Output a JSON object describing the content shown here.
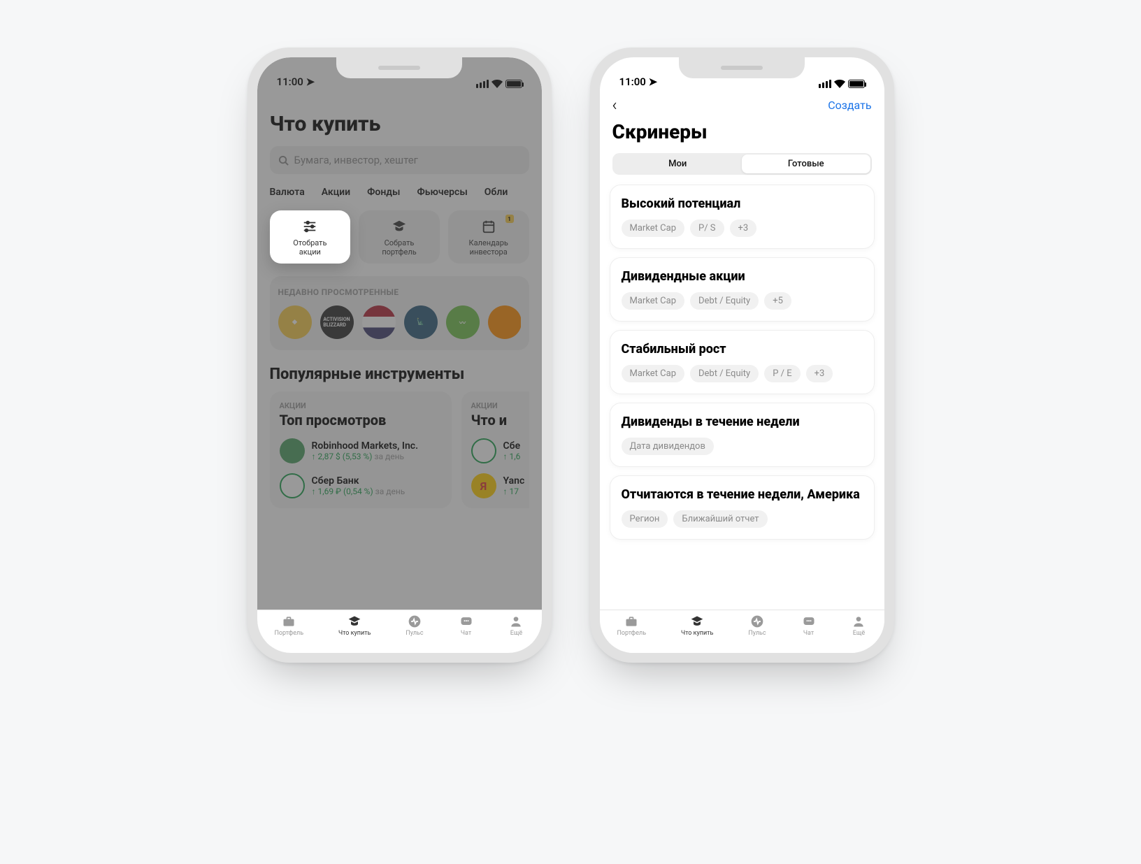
{
  "statusbar": {
    "time": "11:00"
  },
  "left": {
    "title": "Что купить",
    "search_placeholder": "Бумага, инвестор, хештег",
    "categories": [
      "Валюта",
      "Акции",
      "Фонды",
      "Фьючерсы",
      "Обли"
    ],
    "quick": [
      {
        "label": "Отобрать\nакции"
      },
      {
        "label": "Собрать\nпортфель"
      },
      {
        "label": "Календарь\nинвестора",
        "badge": "1"
      }
    ],
    "recent_label": "НЕДАВНО ПРОСМОТРЕННЫЕ",
    "popular_title": "Популярные инструменты",
    "cards": [
      {
        "cat": "АКЦИИ",
        "title": "Топ просмотров",
        "items": [
          {
            "name": "Robinhood Markets, Inc.",
            "delta": "↑ 2,87 $ (5,53 %)",
            "period": "за день"
          },
          {
            "name": "Сбер Банк",
            "delta": "↑ 1,69 ₽ (0,54 %)",
            "period": "за день"
          }
        ]
      },
      {
        "cat": "АКЦИИ",
        "title": "Что и",
        "items": [
          {
            "name": "Сбе",
            "delta": "↑ 1,6",
            "period": ""
          },
          {
            "name": "Yanc",
            "delta": "↑ 17",
            "period": ""
          }
        ]
      }
    ]
  },
  "right": {
    "create": "Создать",
    "title": "Скринеры",
    "segments": [
      "Мои",
      "Готовые"
    ],
    "screeners": [
      {
        "title": "Высокий потенциал",
        "chips": [
          "Market Cap",
          "P/ S",
          "+3"
        ]
      },
      {
        "title": "Дивидендные акции",
        "chips": [
          "Market Cap",
          "Debt / Equity",
          "+5"
        ]
      },
      {
        "title": "Стабильный рост",
        "chips": [
          "Market Cap",
          "Debt / Equity",
          "P / E",
          "+3"
        ]
      },
      {
        "title": "Дивиденды в течение недели",
        "chips": [
          "Дата дивидендов"
        ]
      },
      {
        "title": "Отчитаются в течение недели, Америка",
        "chips": [
          "Регион",
          "Ближайший отчет"
        ]
      }
    ]
  },
  "tabs": [
    {
      "label": "Портфель"
    },
    {
      "label": "Что купить"
    },
    {
      "label": "Пульс"
    },
    {
      "label": "Чат"
    },
    {
      "label": "Ещё"
    }
  ]
}
